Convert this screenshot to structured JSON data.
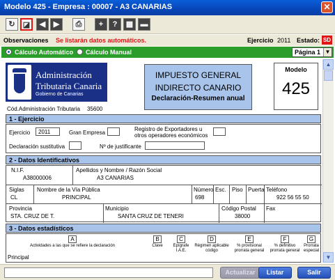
{
  "window": {
    "title": "Modelo 425 - Empresa : 00007 - A3 CANARIAS",
    "close": "✕"
  },
  "toolbar": {
    "buttons": [
      "↻",
      "◪",
      "◀",
      "▶",
      "⎙",
      "+",
      "?",
      "▦",
      "▬"
    ]
  },
  "obs": {
    "label": "Observaciones",
    "message": "Se listarán datos automáticos.",
    "ejercicio_label": "Ejercicio",
    "ejercicio_value": "2011",
    "estado_label": "Estado:",
    "estado_value": "SD"
  },
  "calc": {
    "auto_label": "Cálculo Automático",
    "manual_label": "Cálculo Manual",
    "selected": "auto",
    "pagina_value": "Página 1"
  },
  "header": {
    "logo_l1": "Administración",
    "logo_l2": "Tributaria Canaria",
    "logo_l3": "Gobierno de Canarias",
    "imp_t1": "IMPUESTO GENERAL",
    "imp_t2": "INDIRECTO CANARIO",
    "imp_t3": "Declaración-Resumen anual",
    "modelo_label": "Modelo",
    "modelo_value": "425",
    "codigo_label": "Cód.Administración Tributaria",
    "codigo_value": "35600"
  },
  "sec1": {
    "title": "1 - Ejercicio",
    "ejercicio_label": "Ejercicio",
    "ejercicio_value": "2011",
    "gran_empresa_label": "Gran Empresa",
    "registro_label_1": "Registro de Exportadores u",
    "registro_label_2": "otros operadores económicos",
    "decl_sust_label": "Declaración sustitutiva",
    "justificante_label": "Nº de justificante"
  },
  "sec2": {
    "title": "2 - Datos Identificativos",
    "nif_label": "N.I.F.",
    "nif_value": "A38000006",
    "nombre_label": "Apellidos y Nombre / Razón Social",
    "nombre_value": "A3 CANARIAS",
    "siglas_label": "Siglas",
    "siglas_value": "CL",
    "via_label": "Nombre de la Vía Pública",
    "via_value": "PRINCIPAL",
    "numero_label": "Número",
    "numero_value": "698",
    "esc_label": "Esc.",
    "piso_label": "Piso",
    "puerta_label": "Puerta",
    "telefono_label": "Teléfono",
    "telefono_value": "922 56 55 50",
    "provincia_label": "Provincia",
    "provincia_value": "STA. CRUZ DE T.",
    "municipio_label": "Municipio",
    "municipio_value": "SANTA CRUZ DE TENERI",
    "cp_label": "Código Postal",
    "cp_value": "38000",
    "fax_label": "Fax"
  },
  "sec3": {
    "title": "3 - Datos estadísticos",
    "principal_label": "Principal",
    "columns": [
      {
        "letter": "A",
        "text": "Actividades a las que se refiere la declaración"
      },
      {
        "letter": "B",
        "text": "Clave"
      },
      {
        "letter": "C",
        "text": "Epígrafe I.A.E."
      },
      {
        "letter": "D",
        "text": "Régimen aplicable código"
      },
      {
        "letter": "E",
        "text": "% provisional prorrata general"
      },
      {
        "letter": "F",
        "text": "% definitivo prorrata general"
      },
      {
        "letter": "G",
        "text": "Prorrata especial"
      }
    ]
  },
  "buttons": {
    "actualizar": "Actualizar",
    "listar": "Listar",
    "salir": "Salir"
  },
  "scroll": {
    "up": "▲",
    "down": "▼"
  }
}
